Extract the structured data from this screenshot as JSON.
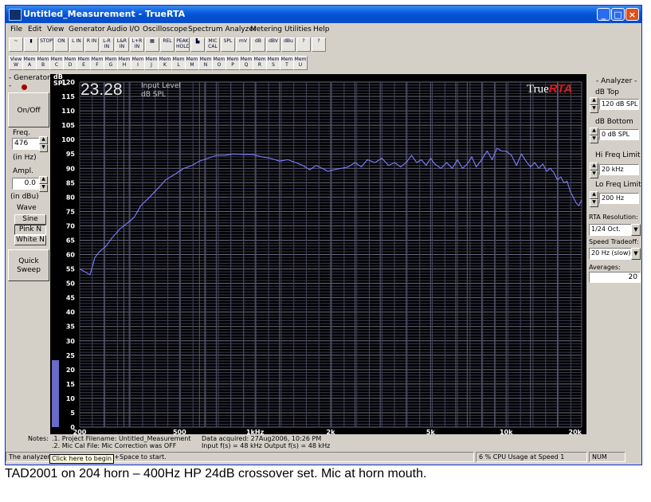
{
  "window": {
    "title": "Untitled_Measurement - TrueRTA",
    "controls": [
      "_",
      "□",
      "×"
    ]
  },
  "menu": [
    "File",
    "Edit",
    "View",
    "Generator",
    "Audio I/O",
    "Oscilloscope",
    "Spectrum Analyzer",
    "Metering",
    "Utilities",
    "Help"
  ],
  "toolbar1": [
    "~",
    "▮",
    "STOP",
    "ON",
    "L IN",
    "R IN",
    "L-R IN",
    "L&R IN",
    "L+R IN",
    "▦",
    "REL",
    "PEAK HOLD",
    "▙",
    "MIC CAL",
    "SPL",
    "mV",
    "dB",
    "dBV",
    "dBu",
    "?",
    "?"
  ],
  "toolbar2": [
    "View W",
    "Mem A",
    "Mem B",
    "Mem C",
    "Mem D",
    "Mem E",
    "Mem F",
    "Mem G",
    "Mem H",
    "Mem I",
    "Mem J",
    "Mem K",
    "Mem L",
    "Mem M",
    "Mem N",
    "Mem O",
    "Mem P",
    "Mem Q",
    "Mem R",
    "Mem S",
    "Mem T",
    "Mem U"
  ],
  "generator": {
    "header": "- Generator -",
    "onoff": "On/Off",
    "freq_label": "Freq.",
    "freq_value": "476",
    "freq_unit": "(in Hz)",
    "ampl_label": "Ampl.",
    "ampl_value": "0.0",
    "ampl_unit": "(in dBu)",
    "wave_label": "Wave",
    "wave_sine": "Sine",
    "wave_pink": "Pink N",
    "wave_white": "White N",
    "quick_sweep": "Quick Sweep"
  },
  "analyzer_panel": {
    "header": "- Analyzer -",
    "db_top_label": "dB Top",
    "db_top_value": "120 dB SPL",
    "db_bottom_label": "dB Bottom",
    "db_bottom_value": "0 dB SPL",
    "hi_freq_label": "Hi Freq Limit",
    "hi_freq_value": "20 kHz",
    "lo_freq_label": "Lo Freq Limit",
    "lo_freq_value": "200 Hz",
    "rta_res_label": "RTA Resolution:",
    "rta_res_value": "1/24 Oct.",
    "speed_label": "Speed Tradeoff:",
    "speed_value": "20 Hz (slow)",
    "averages_label": "Averages:",
    "averages_value": "20"
  },
  "plot": {
    "unit_line1": "dB",
    "unit_line2": "SPL",
    "level_value": "23.28",
    "level_label1": "Input Level",
    "level_label2": "dB SPL",
    "logo_true": "True",
    "logo_rta": "RTA"
  },
  "notes": {
    "label": "Notes:",
    "line1": ".1. Project Filename: Untitled_Measurement",
    "line2": ".2. Mic Cal File: Mic Correction was OFF",
    "acquired": "Data acquired: 27Aug2006, 10:26 PM",
    "rates": "Input f(s) = 48 kHz   Output f(s) = 48 kHz"
  },
  "status": {
    "left": "The analyzer",
    "left_rest": "k+Space to start.",
    "tooltip": "Click here to begin",
    "cpu": "6 % CPU Usage at Speed 1",
    "num": "NUM"
  },
  "caption": "TAD2001 on 204 horn – 400Hz HP 24dB crossover set.  Mic at horn mouth.",
  "colors": {
    "trace": "#7c80ff",
    "grid": "#5a5a70",
    "level_bar": "#6a6ac8",
    "logo_rta": "#e01818"
  },
  "chart_data": {
    "type": "line",
    "x_scale": "log",
    "xlim": [
      200,
      20000
    ],
    "ylim": [
      0,
      120
    ],
    "yticks": [
      120,
      115,
      110,
      105,
      100,
      95,
      90,
      85,
      80,
      75,
      70,
      65,
      60,
      55,
      50,
      45,
      40,
      35,
      30,
      25,
      20,
      15,
      10,
      5,
      0
    ],
    "xticks": [
      {
        "v": 200,
        "label": "200"
      },
      {
        "v": 500,
        "label": "500"
      },
      {
        "v": 1000,
        "label": "1kHz"
      },
      {
        "v": 2000,
        "label": "2k"
      },
      {
        "v": 5000,
        "label": "5k"
      },
      {
        "v": 10000,
        "label": "10k"
      },
      {
        "v": 20000,
        "label": "20k"
      }
    ],
    "ylabel": "dB SPL",
    "input_level_bar": 23.28,
    "series": [
      {
        "x": [
          200,
          210,
          220,
          230,
          240,
          255,
          270,
          290,
          310,
          330,
          350,
          380,
          410,
          440,
          480,
          520,
          560,
          600,
          650,
          700,
          760,
          820,
          900,
          980,
          1060,
          1150,
          1250,
          1350,
          1450,
          1550,
          1650,
          1750,
          1850,
          1950,
          2050,
          2200,
          2350,
          2500,
          2650,
          2800,
          3000,
          3200,
          3400,
          3600,
          3800,
          4000,
          4200,
          4400,
          4600,
          4800,
          5000,
          5200,
          5500,
          5800,
          6100,
          6400,
          6700,
          7000,
          7300,
          7600,
          8000,
          8400,
          8800,
          9200,
          9600,
          10000,
          10500,
          11000,
          11500,
          12000,
          12500,
          13000,
          13500,
          14000,
          14500,
          15000,
          15500,
          16000,
          16500,
          17000,
          17500,
          18000,
          18500,
          19000,
          19500,
          20000
        ],
        "y": [
          55,
          54,
          53,
          59,
          61,
          63,
          66,
          69,
          71,
          73,
          77,
          80,
          83,
          86,
          88,
          90,
          91,
          92.5,
          93.5,
          94.5,
          94.5,
          95,
          94.8,
          94.8,
          94,
          93.5,
          92.5,
          93,
          92,
          91,
          89.5,
          91,
          90,
          89,
          89.5,
          90,
          90.5,
          92,
          90.5,
          93,
          92,
          93.5,
          91,
          92,
          90.5,
          92,
          94.5,
          92,
          93,
          91,
          93.5,
          91.5,
          90,
          92,
          90,
          93,
          90,
          91.5,
          94,
          90.5,
          93,
          96,
          93,
          97,
          96,
          96,
          94.5,
          91,
          95,
          92.5,
          90.5,
          92,
          90,
          91.5,
          89,
          90,
          88.5,
          86,
          87,
          85,
          85.5,
          82,
          80,
          78,
          77,
          79
        ]
      }
    ]
  }
}
